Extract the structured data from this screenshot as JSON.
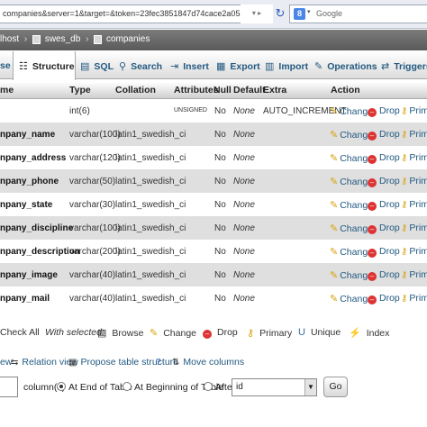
{
  "browser": {
    "url": "companies&server=1&target=&token=23fec3851847d74cace2a05c10171ddf#PMAURL-1:tbl_structu",
    "search_engine_label": "Google"
  },
  "breadcrumb": [
    "lhost",
    "swes_db",
    "companies"
  ],
  "tabs": [
    {
      "label": "se",
      "icon": "browse-icon"
    },
    {
      "label": "Structure",
      "icon": "structure-icon",
      "active": true
    },
    {
      "label": "SQL",
      "icon": "sql-icon"
    },
    {
      "label": "Search",
      "icon": "search-icon"
    },
    {
      "label": "Insert",
      "icon": "insert-icon"
    },
    {
      "label": "Export",
      "icon": "export-icon"
    },
    {
      "label": "Import",
      "icon": "import-icon"
    },
    {
      "label": "Operations",
      "icon": "operations-icon"
    },
    {
      "label": "Triggers",
      "icon": "triggers-icon"
    }
  ],
  "table": {
    "headers": [
      "me",
      "Type",
      "Collation",
      "Attributes",
      "Null",
      "Default",
      "Extra",
      "Action"
    ],
    "rows": [
      {
        "name": "",
        "type": "int(6)",
        "collation": "",
        "attributes": "UNSIGNED",
        "null": "No",
        "default": "None",
        "extra": "AUTO_INCREMENT"
      },
      {
        "name": "npany_name",
        "type": "varchar(100)",
        "collation": "latin1_swedish_ci",
        "attributes": "",
        "null": "No",
        "default": "None",
        "extra": ""
      },
      {
        "name": "npany_address",
        "type": "varchar(120)",
        "collation": "latin1_swedish_ci",
        "attributes": "",
        "null": "No",
        "default": "None",
        "extra": ""
      },
      {
        "name": "npany_phone",
        "type": "varchar(50)",
        "collation": "latin1_swedish_ci",
        "attributes": "",
        "null": "No",
        "default": "None",
        "extra": ""
      },
      {
        "name": "npany_state",
        "type": "varchar(30)",
        "collation": "latin1_swedish_ci",
        "attributes": "",
        "null": "No",
        "default": "None",
        "extra": ""
      },
      {
        "name": "npany_discipline",
        "type": "varchar(100)",
        "collation": "latin1_swedish_ci",
        "attributes": "",
        "null": "No",
        "default": "None",
        "extra": ""
      },
      {
        "name": "npany_description",
        "type": "varchar(200)",
        "collation": "latin1_swedish_ci",
        "attributes": "",
        "null": "No",
        "default": "None",
        "extra": ""
      },
      {
        "name": "npany_image",
        "type": "varchar(40)",
        "collation": "latin1_swedish_ci",
        "attributes": "",
        "null": "No",
        "default": "None",
        "extra": ""
      },
      {
        "name": "npany_mail",
        "type": "varchar(40)",
        "collation": "latin1_swedish_ci",
        "attributes": "",
        "null": "No",
        "default": "None",
        "extra": ""
      }
    ],
    "actions": {
      "change": "Change",
      "drop": "Drop",
      "primary": "Prima"
    }
  },
  "with_selected": {
    "check_all": "Check All",
    "label": "With selected:",
    "buttons": [
      "Browse",
      "Change",
      "Drop",
      "Primary",
      "Unique",
      "Index"
    ]
  },
  "links": {
    "print_view": "ew",
    "relation_view": "Relation view",
    "propose": "Propose table structure",
    "move_columns": "Move columns"
  },
  "add_column": {
    "count_value": "",
    "columns_label": "column(s)",
    "end_of_table": "At End of Table",
    "beginning_of_table": "At Beginning of Table",
    "after": "After",
    "after_field": "id",
    "go": "Go"
  },
  "colors": {
    "link": "#235a81",
    "row_even": "#dfdfdf",
    "breadcrumb_bg": "#6b6b6b"
  }
}
